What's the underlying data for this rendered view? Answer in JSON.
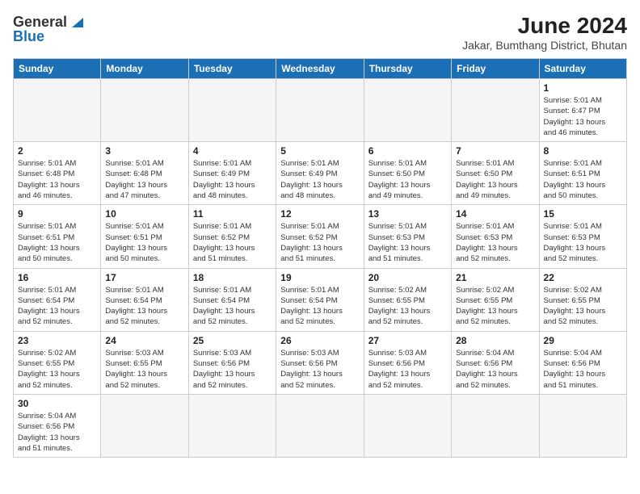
{
  "header": {
    "logo_general": "General",
    "logo_blue": "Blue",
    "month_year": "June 2024",
    "location": "Jakar, Bumthang District, Bhutan"
  },
  "days_of_week": [
    "Sunday",
    "Monday",
    "Tuesday",
    "Wednesday",
    "Thursday",
    "Friday",
    "Saturday"
  ],
  "weeks": [
    [
      {
        "day": "",
        "empty": true
      },
      {
        "day": "",
        "empty": true
      },
      {
        "day": "",
        "empty": true
      },
      {
        "day": "",
        "empty": true
      },
      {
        "day": "",
        "empty": true
      },
      {
        "day": "",
        "empty": true
      },
      {
        "day": "1",
        "sunrise": "5:01 AM",
        "sunset": "6:47 PM",
        "daylight": "13 hours and 46 minutes."
      }
    ],
    [
      {
        "day": "2",
        "sunrise": "5:01 AM",
        "sunset": "6:48 PM",
        "daylight": "13 hours and 46 minutes."
      },
      {
        "day": "3",
        "sunrise": "5:01 AM",
        "sunset": "6:48 PM",
        "daylight": "13 hours and 47 minutes."
      },
      {
        "day": "4",
        "sunrise": "5:01 AM",
        "sunset": "6:49 PM",
        "daylight": "13 hours and 48 minutes."
      },
      {
        "day": "5",
        "sunrise": "5:01 AM",
        "sunset": "6:49 PM",
        "daylight": "13 hours and 48 minutes."
      },
      {
        "day": "6",
        "sunrise": "5:01 AM",
        "sunset": "6:50 PM",
        "daylight": "13 hours and 49 minutes."
      },
      {
        "day": "7",
        "sunrise": "5:01 AM",
        "sunset": "6:50 PM",
        "daylight": "13 hours and 49 minutes."
      },
      {
        "day": "8",
        "sunrise": "5:01 AM",
        "sunset": "6:51 PM",
        "daylight": "13 hours and 50 minutes."
      }
    ],
    [
      {
        "day": "9",
        "sunrise": "5:01 AM",
        "sunset": "6:51 PM",
        "daylight": "13 hours and 50 minutes."
      },
      {
        "day": "10",
        "sunrise": "5:01 AM",
        "sunset": "6:51 PM",
        "daylight": "13 hours and 50 minutes."
      },
      {
        "day": "11",
        "sunrise": "5:01 AM",
        "sunset": "6:52 PM",
        "daylight": "13 hours and 51 minutes."
      },
      {
        "day": "12",
        "sunrise": "5:01 AM",
        "sunset": "6:52 PM",
        "daylight": "13 hours and 51 minutes."
      },
      {
        "day": "13",
        "sunrise": "5:01 AM",
        "sunset": "6:53 PM",
        "daylight": "13 hours and 51 minutes."
      },
      {
        "day": "14",
        "sunrise": "5:01 AM",
        "sunset": "6:53 PM",
        "daylight": "13 hours and 52 minutes."
      },
      {
        "day": "15",
        "sunrise": "5:01 AM",
        "sunset": "6:53 PM",
        "daylight": "13 hours and 52 minutes."
      }
    ],
    [
      {
        "day": "16",
        "sunrise": "5:01 AM",
        "sunset": "6:54 PM",
        "daylight": "13 hours and 52 minutes."
      },
      {
        "day": "17",
        "sunrise": "5:01 AM",
        "sunset": "6:54 PM",
        "daylight": "13 hours and 52 minutes."
      },
      {
        "day": "18",
        "sunrise": "5:01 AM",
        "sunset": "6:54 PM",
        "daylight": "13 hours and 52 minutes."
      },
      {
        "day": "19",
        "sunrise": "5:01 AM",
        "sunset": "6:54 PM",
        "daylight": "13 hours and 52 minutes."
      },
      {
        "day": "20",
        "sunrise": "5:02 AM",
        "sunset": "6:55 PM",
        "daylight": "13 hours and 52 minutes."
      },
      {
        "day": "21",
        "sunrise": "5:02 AM",
        "sunset": "6:55 PM",
        "daylight": "13 hours and 52 minutes."
      },
      {
        "day": "22",
        "sunrise": "5:02 AM",
        "sunset": "6:55 PM",
        "daylight": "13 hours and 52 minutes."
      }
    ],
    [
      {
        "day": "23",
        "sunrise": "5:02 AM",
        "sunset": "6:55 PM",
        "daylight": "13 hours and 52 minutes."
      },
      {
        "day": "24",
        "sunrise": "5:03 AM",
        "sunset": "6:55 PM",
        "daylight": "13 hours and 52 minutes."
      },
      {
        "day": "25",
        "sunrise": "5:03 AM",
        "sunset": "6:56 PM",
        "daylight": "13 hours and 52 minutes."
      },
      {
        "day": "26",
        "sunrise": "5:03 AM",
        "sunset": "6:56 PM",
        "daylight": "13 hours and 52 minutes."
      },
      {
        "day": "27",
        "sunrise": "5:03 AM",
        "sunset": "6:56 PM",
        "daylight": "13 hours and 52 minutes."
      },
      {
        "day": "28",
        "sunrise": "5:04 AM",
        "sunset": "6:56 PM",
        "daylight": "13 hours and 52 minutes."
      },
      {
        "day": "29",
        "sunrise": "5:04 AM",
        "sunset": "6:56 PM",
        "daylight": "13 hours and 51 minutes."
      }
    ],
    [
      {
        "day": "30",
        "sunrise": "5:04 AM",
        "sunset": "6:56 PM",
        "daylight": "13 hours and 51 minutes."
      },
      {
        "day": "",
        "empty": true
      },
      {
        "day": "",
        "empty": true
      },
      {
        "day": "",
        "empty": true
      },
      {
        "day": "",
        "empty": true
      },
      {
        "day": "",
        "empty": true
      },
      {
        "day": "",
        "empty": true
      }
    ]
  ],
  "labels": {
    "sunrise": "Sunrise:",
    "sunset": "Sunset:",
    "daylight": "Daylight:"
  }
}
